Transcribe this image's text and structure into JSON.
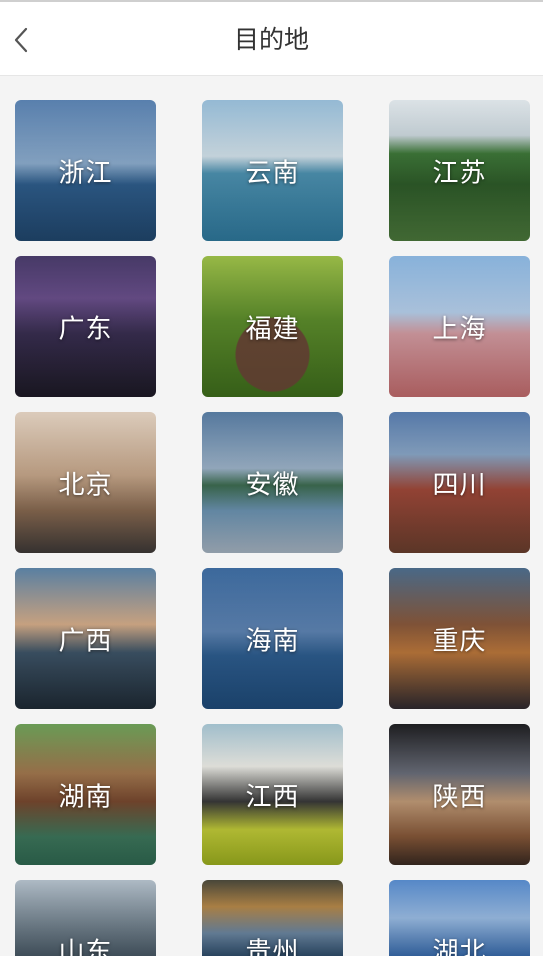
{
  "header": {
    "title": "目的地",
    "back_icon": "chevron-left-icon"
  },
  "destinations": [
    {
      "label": "浙江"
    },
    {
      "label": "云南"
    },
    {
      "label": "江苏"
    },
    {
      "label": "广东"
    },
    {
      "label": "福建"
    },
    {
      "label": "上海"
    },
    {
      "label": "北京"
    },
    {
      "label": "安徽"
    },
    {
      "label": "四川"
    },
    {
      "label": "广西"
    },
    {
      "label": "海南"
    },
    {
      "label": "重庆"
    },
    {
      "label": "湖南"
    },
    {
      "label": "江西"
    },
    {
      "label": "陕西"
    },
    {
      "label": "山东"
    },
    {
      "label": "贵州"
    },
    {
      "label": "湖北"
    }
  ],
  "colors": {
    "page_bg": "#f4f4f4",
    "header_bg": "#ffffff",
    "title_text": "#333333",
    "tile_label": "#ffffff"
  }
}
